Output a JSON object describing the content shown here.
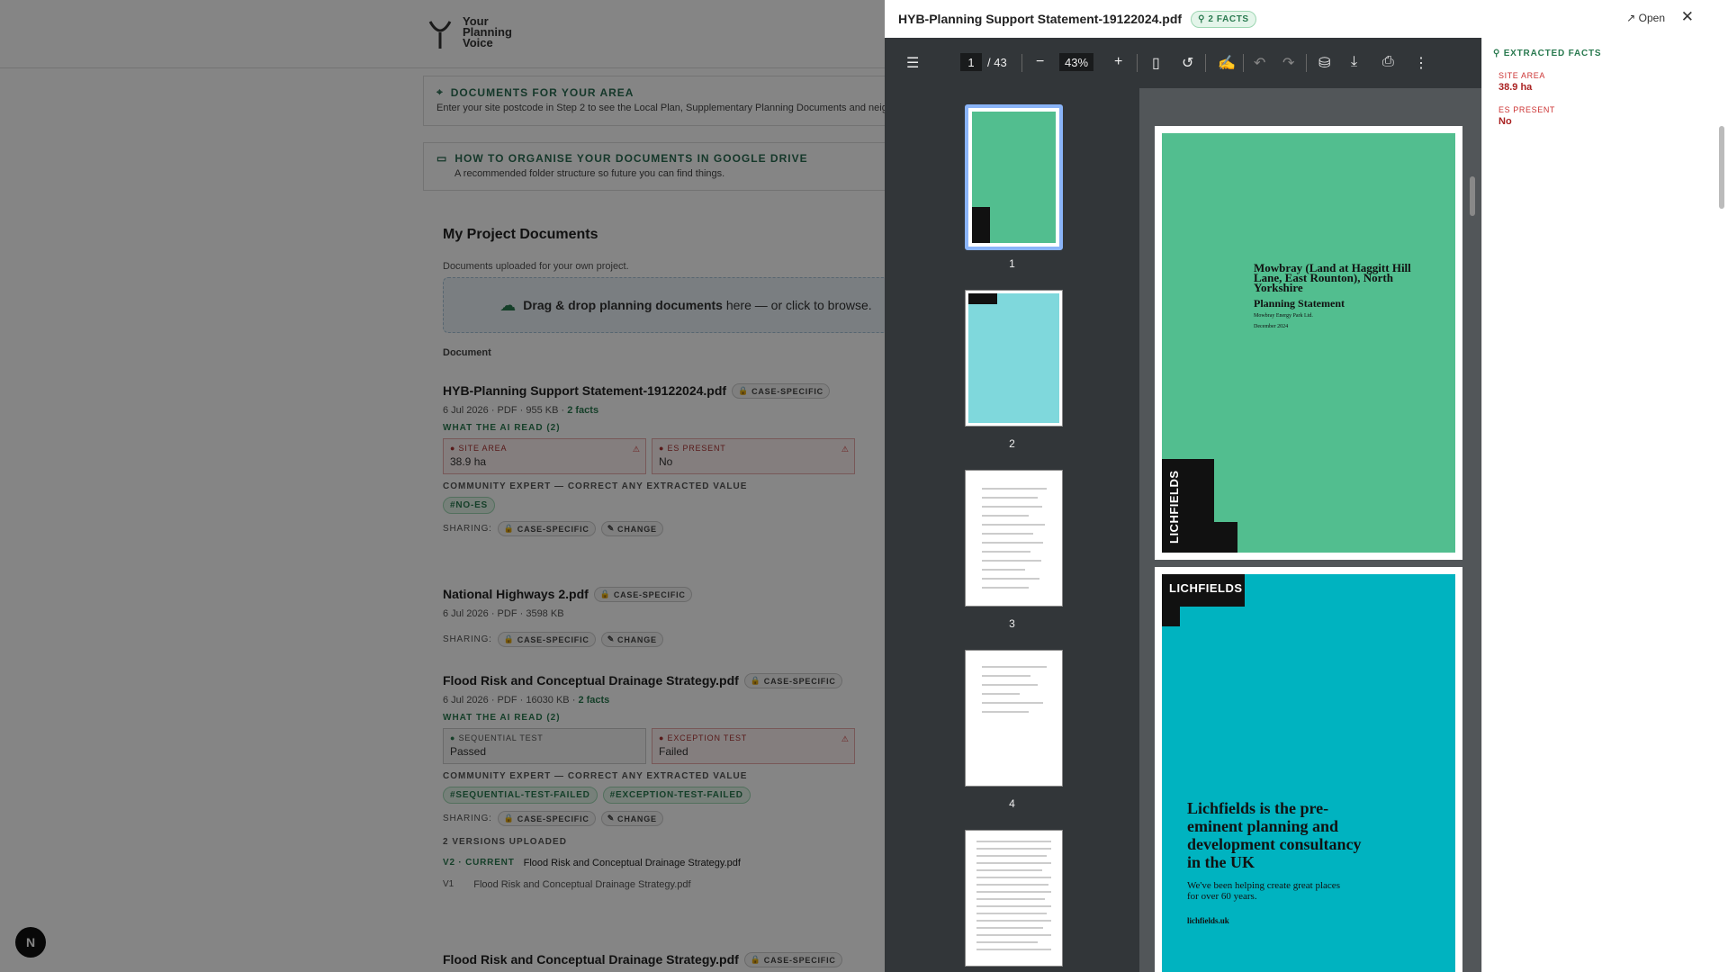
{
  "brand": {
    "name": "Your\nPlanning\nVoice"
  },
  "cards": [
    {
      "title": "DOCUMENTS FOR YOUR AREA",
      "subtitle": "Enter your site postcode in Step 2 to see the Local Plan, Supplementary Planning Documents and neigh"
    },
    {
      "title": "HOW TO ORGANISE YOUR DOCUMENTS IN GOOGLE DRIVE",
      "subtitle": "A recommended folder structure so future you can find things."
    }
  ],
  "project": {
    "heading": "My Project Documents",
    "sub": "Documents uploaded for your own project.",
    "drop_bold": "Drag & drop planning documents",
    "drop_rest": " here — or click to browse.",
    "col_header": "Document"
  },
  "docs": [
    {
      "name": "HYB-Planning Support Statement-19122024.pdf",
      "chip": "CASE-SPECIFIC",
      "date": "6 Jul 2026",
      "type": "PDF",
      "size": "955 KB",
      "facts_count": "2 facts",
      "ai_label": "WHAT THE AI READ (2)",
      "facts": [
        {
          "k": "SITE AREA",
          "v": "38.9 ha"
        },
        {
          "k": "ES PRESENT",
          "v": "No"
        }
      ],
      "expert_label": "COMMUNITY EXPERT — CORRECT ANY EXTRACTED VALUE",
      "tags": [
        "#NO-ES"
      ],
      "sharing": "SHARING:",
      "share_chip": "CASE-SPECIFIC",
      "change": "CHANGE"
    },
    {
      "name": "National Highways 2.pdf",
      "chip": "CASE-SPECIFIC",
      "date": "6 Jul 2026",
      "type": "PDF",
      "size": "3598 KB",
      "sharing": "SHARING:",
      "share_chip": "CASE-SPECIFIC",
      "change": "CHANGE"
    },
    {
      "name": "Flood Risk and Conceptual Drainage Strategy.pdf",
      "chip": "CASE-SPECIFIC",
      "date": "6 Jul 2026",
      "type": "PDF",
      "size": "16030 KB",
      "facts_count": "2 facts",
      "ai_label": "WHAT THE AI READ (2)",
      "facts": [
        {
          "k": "SEQUENTIAL TEST",
          "v": "Passed"
        },
        {
          "k": "EXCEPTION TEST",
          "v": "Failed"
        }
      ],
      "expert_label": "COMMUNITY EXPERT — CORRECT ANY EXTRACTED VALUE",
      "tags": [
        "#SEQUENTIAL-TEST-FAILED",
        "#EXCEPTION-TEST-FAILED"
      ],
      "sharing": "SHARING:",
      "share_chip": "CASE-SPECIFIC",
      "change": "CHANGE",
      "versions_label": "2 VERSIONS UPLOADED",
      "v2": "V2 · CURRENT",
      "v2_name": "Flood Risk and Conceptual Drainage Strategy.pdf",
      "v1": "V1",
      "v1_name": "Flood Risk and Conceptual Drainage Strategy.pdf"
    },
    {
      "name": "Flood Risk and Conceptual Drainage Strategy.pdf",
      "chip": "CASE-SPECIFIC"
    }
  ],
  "panel": {
    "title": "HYB-Planning Support Statement-19122024.pdf",
    "badge": "2 FACTS",
    "open": "Open",
    "viewer": {
      "page": "1",
      "total": "/ 43",
      "zoom": "43%"
    },
    "thumb_numbers": [
      "1",
      "2",
      "3",
      "4"
    ],
    "page1": {
      "title": "Mowbray (Land at Haggitt Hill Lane, East Rounton), North Yorkshire",
      "sub": "Planning Statement",
      "client": "Mowbray Energy Park Ltd.",
      "date": "December 2024",
      "brand": "LICHFIELDS"
    },
    "page2": {
      "brand": "LICHFIELDS",
      "headline": "Lichfields is the pre-eminent planning and development consultancy in the UK",
      "sub": "We've been helping create great places for over 60 years.",
      "url": "lichfields.uk"
    },
    "facts_header": "EXTRACTED FACTS",
    "facts": [
      {
        "k": "SITE AREA",
        "v": "38.9 ha"
      },
      {
        "k": "ES PRESENT",
        "v": "No"
      }
    ]
  },
  "colors": {
    "accent": "#2a7a50",
    "pdf_green": "#52be8f",
    "pdf_teal": "#00b3c0"
  }
}
